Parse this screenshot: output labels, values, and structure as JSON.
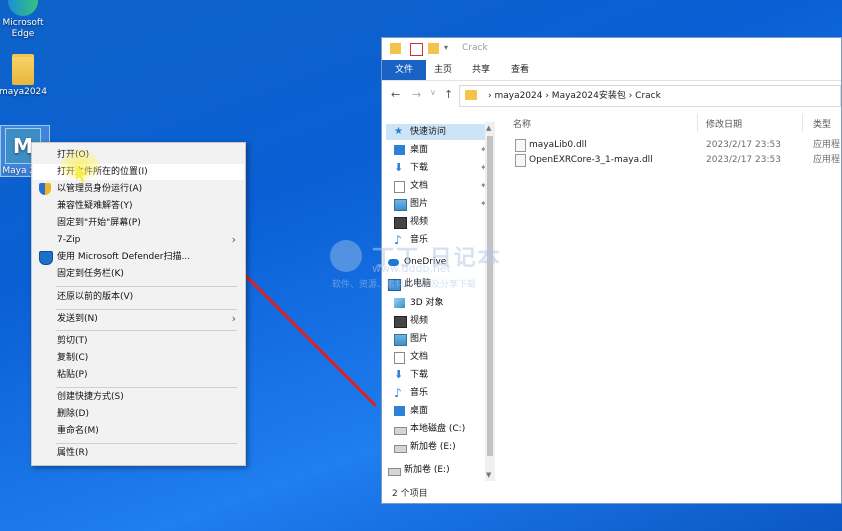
{
  "desktop": {
    "icons": [
      {
        "label": "Microsoft\nEdge"
      },
      {
        "label": "maya2024"
      },
      {
        "label": "Maya 2..."
      }
    ]
  },
  "context_menu": {
    "items": [
      {
        "label": "打开(O)"
      },
      {
        "label": "打开文件所在的位置(I)"
      },
      {
        "label": "以管理员身份运行(A)"
      },
      {
        "label": "兼容性疑难解答(Y)"
      },
      {
        "label": "固定到\"开始\"屏幕(P)"
      },
      {
        "label": "7-Zip",
        "submenu": "›"
      },
      {
        "label": "使用 Microsoft Defender扫描..."
      },
      {
        "label": "固定到任务栏(K)"
      },
      {
        "label": "还原以前的版本(V)"
      },
      {
        "label": "发送到(N)",
        "submenu": "›"
      },
      {
        "label": "剪切(T)"
      },
      {
        "label": "复制(C)"
      },
      {
        "label": "粘贴(P)"
      },
      {
        "label": "创建快捷方式(S)"
      },
      {
        "label": "删除(D)"
      },
      {
        "label": "重命名(M)"
      },
      {
        "label": "属性(R)"
      }
    ]
  },
  "explorer": {
    "title": "Crack",
    "ribbon_tabs": [
      "文件",
      "主页",
      "共享",
      "查看"
    ],
    "nav_buttons": [
      "←",
      "→",
      "∨",
      "↑"
    ],
    "breadcrumb": "›  maya2024  ›  Maya2024安装包  ›  Crack",
    "nav_pane": [
      {
        "label": "快速访问",
        "selected": true,
        "icon": "star-icon"
      },
      {
        "label": "桌面",
        "pinned": true,
        "icon": "desktop-icon"
      },
      {
        "label": "下载",
        "pinned": true,
        "icon": "download-icon"
      },
      {
        "label": "文档",
        "pinned": true,
        "icon": "document-icon"
      },
      {
        "label": "图片",
        "pinned": true,
        "icon": "picture-icon"
      },
      {
        "label": "视频",
        "icon": "video-icon"
      },
      {
        "label": "音乐",
        "icon": "music-icon"
      },
      {
        "label": "OneDrive",
        "icon": "cloud-icon"
      },
      {
        "label": "此电脑",
        "icon": "computer-icon"
      },
      {
        "label": "3D 对象",
        "icon": "cube-icon"
      },
      {
        "label": "视频",
        "icon": "video-icon"
      },
      {
        "label": "图片",
        "icon": "picture-icon"
      },
      {
        "label": "文档",
        "icon": "document-icon"
      },
      {
        "label": "下载",
        "icon": "download-icon"
      },
      {
        "label": "音乐",
        "icon": "music-icon"
      },
      {
        "label": "桌面",
        "icon": "desktop-icon"
      },
      {
        "label": "本地磁盘 (C:)",
        "icon": "drive-icon"
      },
      {
        "label": "新加卷 (E:)",
        "icon": "drive-icon"
      },
      {
        "label": "新加卷 (E:)",
        "icon": "drive-icon"
      }
    ],
    "columns": [
      "名称",
      "修改日期",
      "类型"
    ],
    "files": [
      {
        "name": "mayaLib0.dll",
        "date": "2023/2/17 23:53",
        "type": "应用程"
      },
      {
        "name": "OpenEXRCore-3_1-maya.dll",
        "date": "2023/2/17 23:53",
        "type": "应用程"
      }
    ],
    "status": "2 个项目"
  },
  "watermark": {
    "line1": "丁丁 日记本",
    "line2": "www.dddb.net",
    "line3": "软件、资源、素材日分享及分享下载"
  },
  "colors": {
    "accent": "#1a63c5",
    "selection": "#cce4f7",
    "arrow": "#e02020"
  }
}
